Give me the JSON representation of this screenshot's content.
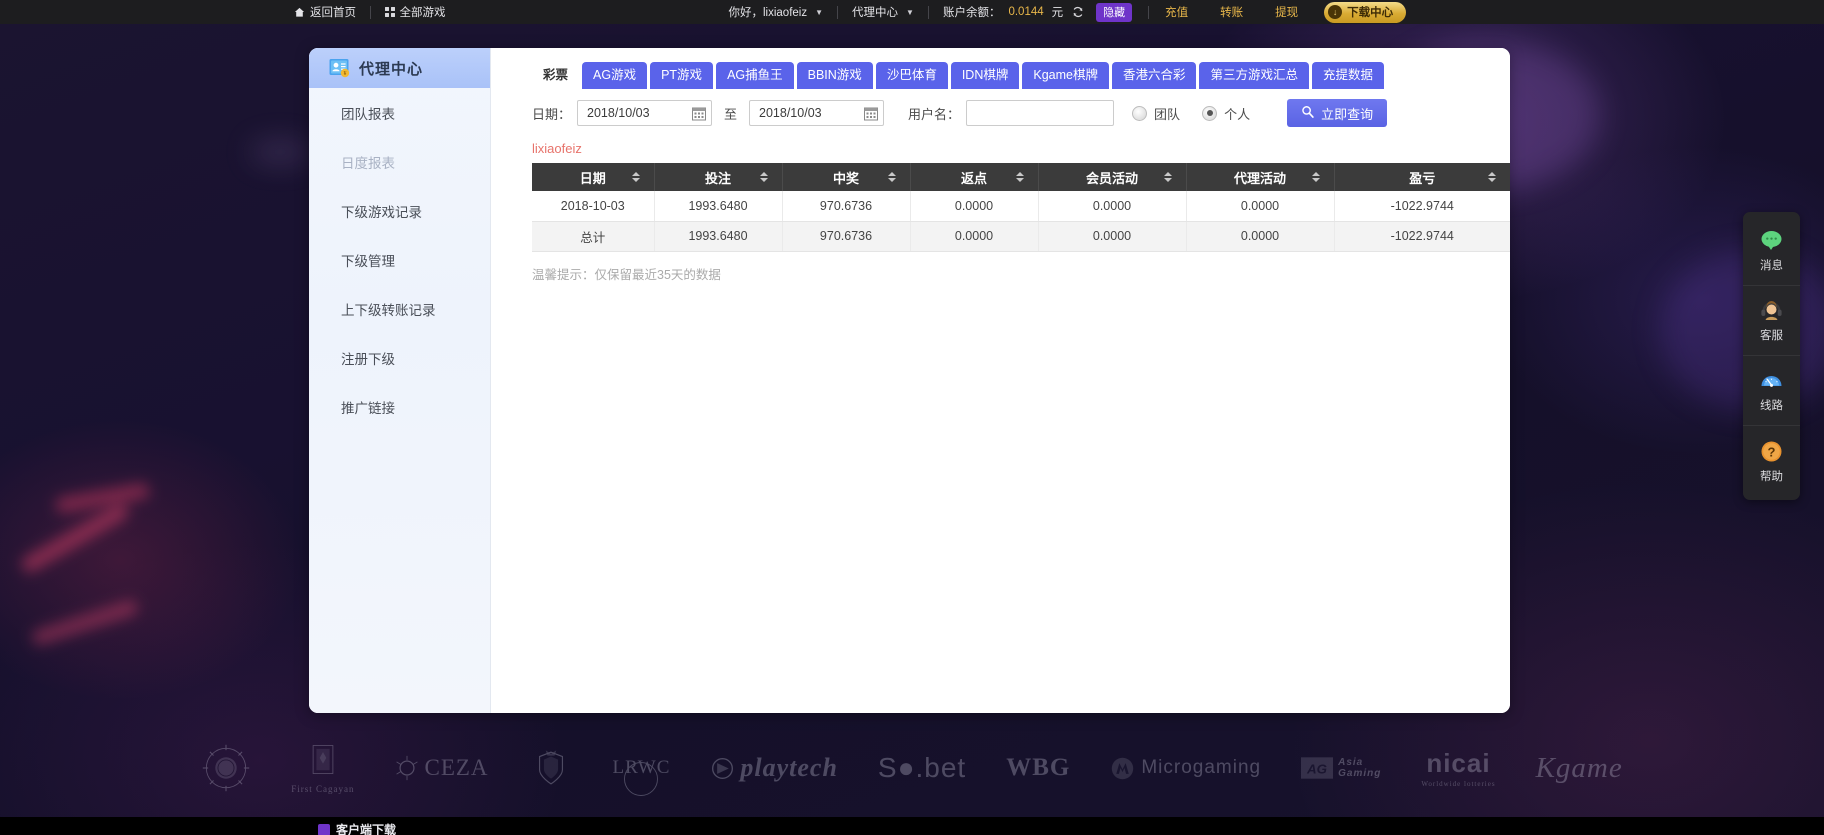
{
  "topbar": {
    "home": "返回首页",
    "all_games": "全部游戏",
    "greeting": "你好，lixiaofeiz",
    "center": "代理中心",
    "balance_label": "账户余额：",
    "balance_value": "0.0144",
    "balance_unit": "元",
    "hide": "隐藏",
    "recharge": "充值",
    "transfer": "转账",
    "withdraw": "提现",
    "download": "下载中心",
    "accent_gold": "#e8b74a",
    "hide_purple": "#6f34c9"
  },
  "sidebar": {
    "title": "代理中心",
    "icon": "agent-card-icon",
    "items": [
      {
        "label": "团队报表",
        "active": false
      },
      {
        "label": "日度报表",
        "active": true
      },
      {
        "label": "下级游戏记录",
        "active": false
      },
      {
        "label": "下级管理",
        "active": false
      },
      {
        "label": "上下级转账记录",
        "active": false
      },
      {
        "label": "注册下级",
        "active": false
      },
      {
        "label": "推广链接",
        "active": false
      }
    ]
  },
  "tabs": [
    {
      "label": "彩票",
      "active": true
    },
    {
      "label": "AG游戏",
      "active": false
    },
    {
      "label": "PT游戏",
      "active": false
    },
    {
      "label": "AG捕鱼王",
      "active": false
    },
    {
      "label": "BBIN游戏",
      "active": false
    },
    {
      "label": "沙巴体育",
      "active": false
    },
    {
      "label": "IDN棋牌",
      "active": false
    },
    {
      "label": "Kgame棋牌",
      "active": false
    },
    {
      "label": "香港六合彩",
      "active": false
    },
    {
      "label": "第三方游戏汇总",
      "active": false
    },
    {
      "label": "充提数据",
      "active": false
    }
  ],
  "filter": {
    "date_label": "日期：",
    "date_from": "2018/10/03",
    "date_to": "2018/10/03",
    "between": "至",
    "user_label": "用户名：",
    "user_value": "",
    "user_placeholder": "",
    "radio_team": "团队",
    "radio_personal": "个人",
    "selected": "个人",
    "query_button": "立即查询"
  },
  "report": {
    "username": "lixiaofeiz",
    "columns": [
      "日期",
      "投注",
      "中奖",
      "返点",
      "会员活动",
      "代理活动",
      "盈亏"
    ],
    "rows": [
      [
        "2018-10-03",
        "1993.6480",
        "970.6736",
        "0.0000",
        "0.0000",
        "0.0000",
        "-1022.9744"
      ]
    ],
    "total_row": [
      "总计",
      "1993.6480",
      "970.6736",
      "0.0000",
      "0.0000",
      "0.0000",
      "-1022.9744"
    ],
    "tip": "温馨提示：仅保留最近35天的数据"
  },
  "dock": [
    {
      "label": "消息",
      "icon": "message-bubble-icon"
    },
    {
      "label": "客服",
      "icon": "headset-agent-icon"
    },
    {
      "label": "线路",
      "icon": "speedometer-icon"
    },
    {
      "label": "帮助",
      "icon": "question-mark-icon"
    }
  ],
  "footer_logos": [
    {
      "name": "globe-seal-logo",
      "text": ""
    },
    {
      "name": "first-cagayan-logo",
      "text": "First Cagayan"
    },
    {
      "name": "ceza-logo",
      "text": "CEZA"
    },
    {
      "name": "crest-logo",
      "text": ""
    },
    {
      "name": "lrwc-logo",
      "text": "LRWC"
    },
    {
      "name": "playtech-logo",
      "text": "playtech"
    },
    {
      "name": "sabet-logo",
      "text": "S●.bet"
    },
    {
      "name": "wbg-logo",
      "text": "WBG"
    },
    {
      "name": "microgaming-logo",
      "text": "Microgaming"
    },
    {
      "name": "ag-asia-gaming-logo",
      "text": "AG Asia Gaming"
    },
    {
      "name": "nicai-logo",
      "text": "nicai"
    },
    {
      "name": "kgame-logo",
      "text": "Kgame"
    }
  ],
  "bottombar": {
    "text": "客户端下载"
  }
}
